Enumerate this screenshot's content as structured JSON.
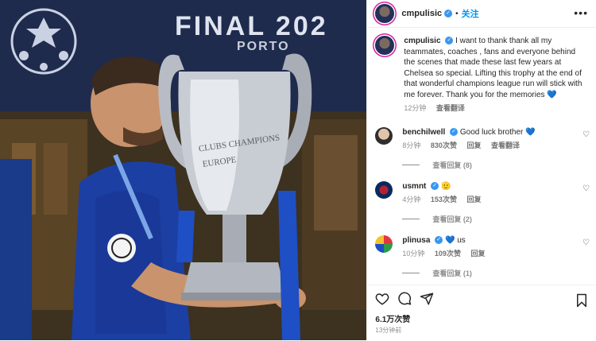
{
  "photo": {
    "top_text": "FINAL 202",
    "sub_text": "PORTO",
    "trophy_engraving": "CLUBS CHAMPIONS EUROPE"
  },
  "header": {
    "username": "cmpulisic",
    "separator": "•",
    "follow_label": "关注",
    "more_icon": "more-icon"
  },
  "caption": {
    "username": "cmpulisic",
    "text": "I want to thank thank all my teammates, coaches , fans and everyone behind the scenes that made these last few years at Chelsea so special. Lifting this trophy at the end of that wonderful champions league run will stick with me forever. Thank you for the memories",
    "emoji": "💙",
    "time": "12分钟",
    "translate": "查看翻译"
  },
  "comments": [
    {
      "username": "benchilwell",
      "text": "Good luck brother",
      "emoji": "💙",
      "time": "8分钟",
      "likes": "830次赞",
      "reply": "回复",
      "translate": "查看翻译",
      "view_replies": "查看回复 (8)"
    },
    {
      "username": "usmnt",
      "text": "🫡",
      "time": "4分钟",
      "likes": "153次赞",
      "reply": "回复",
      "view_replies": "查看回复 (2)"
    },
    {
      "username": "plinusa",
      "text": "us",
      "emoji": "💙",
      "time": "10分钟",
      "likes": "109次赞",
      "reply": "回复",
      "view_replies": "查看回复 (1)"
    }
  ],
  "actions": {
    "like_icon": "heart-icon",
    "comment_icon": "comment-icon",
    "share_icon": "share-icon",
    "save_icon": "bookmark-icon",
    "likes_count": "6.1万次赞",
    "posted_time": "13分钟前"
  },
  "colors": {
    "accent": "#0095f6",
    "verified": "#3897f0",
    "heart_blue": "#1f5fe0",
    "muted": "#8e8e8e"
  }
}
